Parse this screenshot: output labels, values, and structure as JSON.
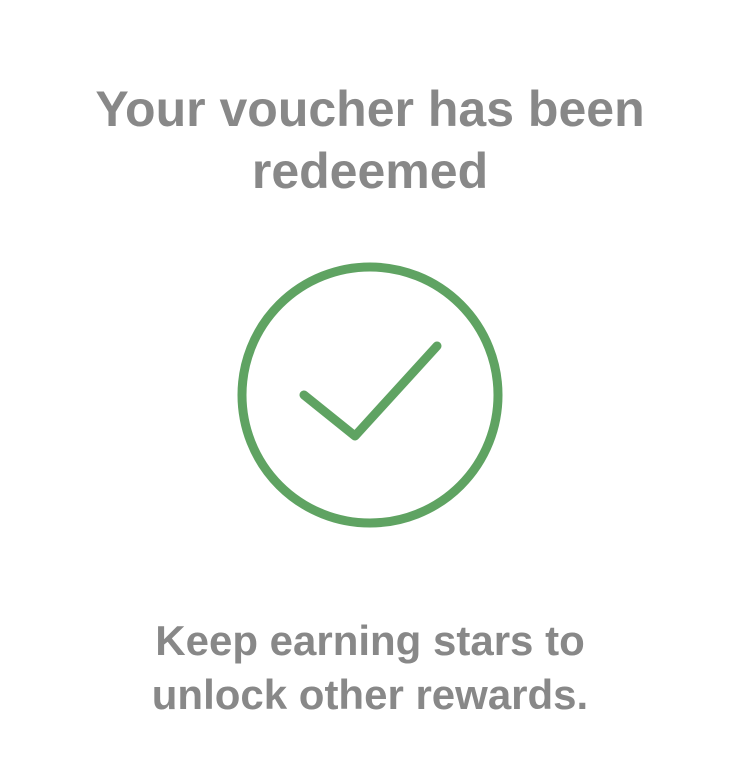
{
  "header": {
    "title_line1": "Your voucher has been",
    "title_line2": "redeemed"
  },
  "icon": {
    "name": "check-circle-icon",
    "color": "#5fa362"
  },
  "footer": {
    "message_line1": "Keep earning stars to",
    "message_line2": "unlock other rewards."
  },
  "colors": {
    "text": "#888888",
    "background": "#ffffff",
    "accent": "#5fa362"
  }
}
